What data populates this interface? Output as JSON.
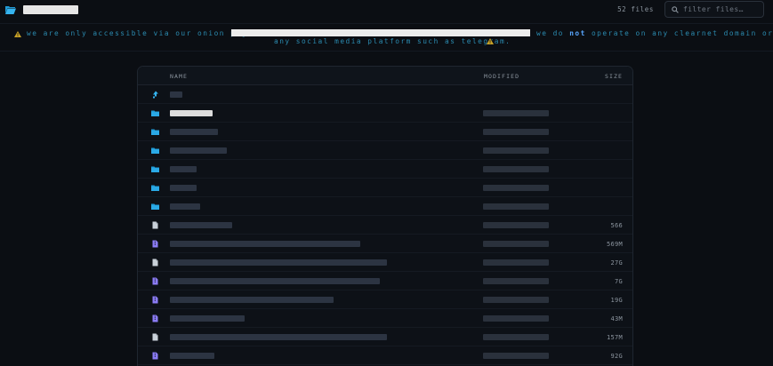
{
  "header": {
    "title": "██████████",
    "file_count": "52 files",
    "filter_placeholder": "filter files…"
  },
  "notice": {
    "line1_before": "we are only accessible via our onion page",
    "onion_url": "████████████████████████████████████████████████████",
    "line1_after_a": "we do",
    "line1_bold": "not",
    "line1_after_b": "operate on any clearnet domain or on",
    "line2": "any social media platform such as telegram."
  },
  "table": {
    "columns": {
      "name": "NAME",
      "modified": "MODIFIED",
      "size": "SIZE"
    },
    "rows": [
      {
        "type": "parent",
        "name": "..",
        "modified": "",
        "size": ""
      },
      {
        "type": "folder",
        "name": "███████",
        "modified": "██████████",
        "size": ""
      },
      {
        "type": "folder",
        "name": "███████████",
        "modified": "██████████",
        "size": ""
      },
      {
        "type": "folder",
        "name": "████████████",
        "modified": "██████████",
        "size": ""
      },
      {
        "type": "folder",
        "name": "█████",
        "modified": "██████████",
        "size": ""
      },
      {
        "type": "folder",
        "name": "█████",
        "modified": "██████████",
        "size": ""
      },
      {
        "type": "folder",
        "name": "██████",
        "modified": "██████████",
        "size": ""
      },
      {
        "type": "file",
        "name": "█████████████",
        "modified": "██████████",
        "size": "566"
      },
      {
        "type": "archive",
        "name": "██████████████████████████████████████",
        "modified": "██████████",
        "size": "569M"
      },
      {
        "type": "file",
        "name": "█████████████████████████████████████████████",
        "modified": "██████████",
        "size": "27G"
      },
      {
        "type": "archive",
        "name": "█████████████████████████████████████████████",
        "modified": "██████████",
        "size": "7G"
      },
      {
        "type": "archive",
        "name": "██████████████████████████████████",
        "modified": "██████████",
        "size": "19G"
      },
      {
        "type": "archive",
        "name": "████████████████",
        "modified": "██████████",
        "size": "43M"
      },
      {
        "type": "file",
        "name": "█████████████████████████████████████████████",
        "modified": "██████████",
        "size": "157M"
      },
      {
        "type": "archive",
        "name": "█████████",
        "modified": "██████████",
        "size": "92G"
      }
    ]
  },
  "colors": {
    "background": "#0b0e13",
    "notice_text": "#2b8bb0",
    "folder_icon": "#1f9bd7",
    "archive_icon": "#8b7cf6",
    "warning_icon": "#c9a227"
  }
}
